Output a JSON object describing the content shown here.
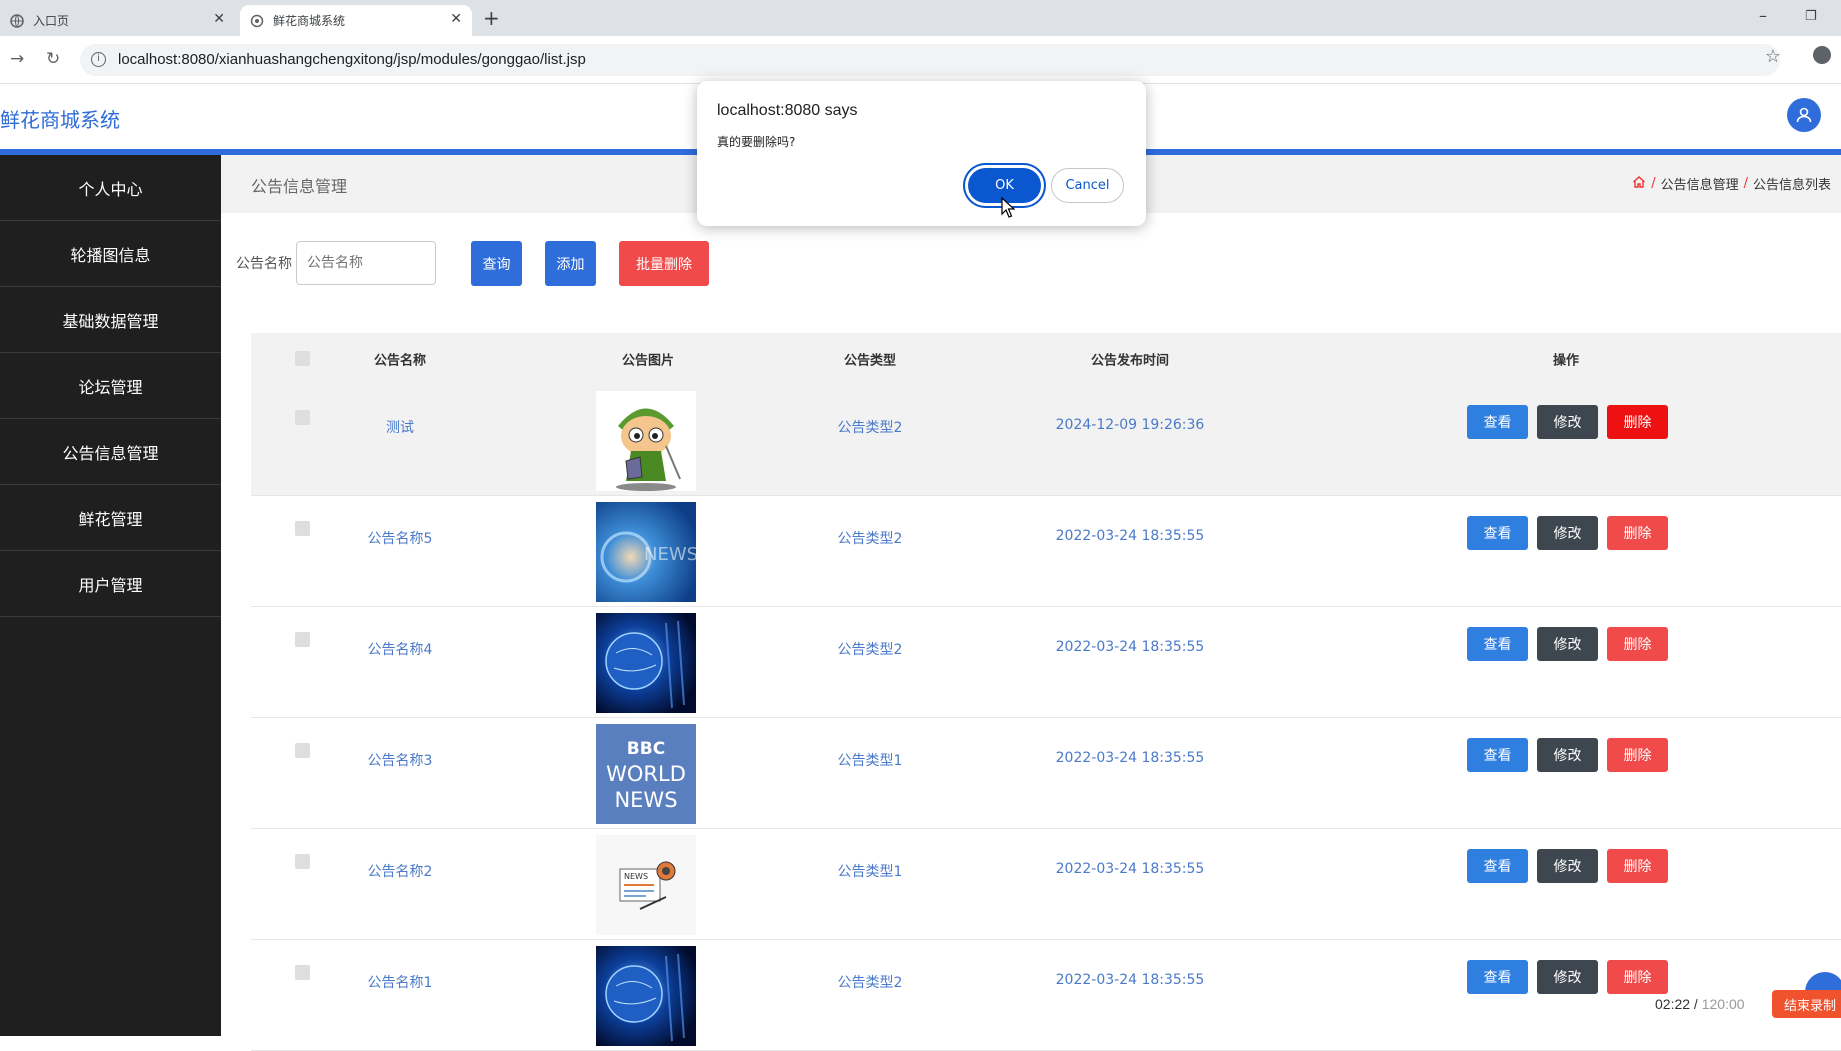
{
  "browser": {
    "tabs": [
      {
        "label": "入口页",
        "active": false
      },
      {
        "label": "鲜花商城系统",
        "active": true
      }
    ],
    "url": "localhost:8080/xianhuashangchengxitong/jsp/modules/gonggao/list.jsp"
  },
  "app": {
    "title": "鲜花商城系统",
    "accent": "#2f6ddb"
  },
  "sidebar": {
    "items": [
      {
        "label": "个人中心"
      },
      {
        "label": "轮播图信息"
      },
      {
        "label": "基础数据管理"
      },
      {
        "label": "论坛管理"
      },
      {
        "label": "公告信息管理"
      },
      {
        "label": "鲜花管理"
      },
      {
        "label": "用户管理"
      }
    ]
  },
  "page": {
    "title": "公告信息管理",
    "breadcrumb": [
      "公告信息管理",
      "公告信息列表"
    ]
  },
  "search": {
    "label": "公告名称",
    "placeholder": "公告名称",
    "query_button": "查询",
    "add_button": "添加",
    "batch_delete_button": "批量删除"
  },
  "table": {
    "columns": [
      "公告名称",
      "公告图片",
      "公告类型",
      "公告发布时间",
      "操作"
    ],
    "actions": {
      "view": "查看",
      "edit": "修改",
      "delete": "删除"
    },
    "rows": [
      {
        "name": "测试",
        "type": "公告类型2",
        "time": "2024-12-09 19:26:36",
        "image": "cartoon-character"
      },
      {
        "name": "公告名称5",
        "type": "公告类型2",
        "time": "2022-03-24 18:35:55",
        "image": "news-blue"
      },
      {
        "name": "公告名称4",
        "type": "公告类型2",
        "time": "2022-03-24 18:35:55",
        "image": "globe"
      },
      {
        "name": "公告名称3",
        "type": "公告类型1",
        "time": "2022-03-24 18:35:55",
        "image": "bbc-world-news"
      },
      {
        "name": "公告名称2",
        "type": "公告类型1",
        "time": "2022-03-24 18:35:55",
        "image": "news-icon"
      },
      {
        "name": "公告名称1",
        "type": "公告类型2",
        "time": "2022-03-24 18:35:55",
        "image": "globe"
      }
    ]
  },
  "dialog": {
    "title": "localhost:8080 says",
    "message": "真的要删除吗?",
    "ok": "OK",
    "cancel": "Cancel"
  },
  "recorder": {
    "elapsed": "02:22",
    "separator": " / ",
    "limit": "120:00",
    "stop_label": "结束录制"
  },
  "bbc_logo_text": [
    "BBC",
    "WORLD",
    "NEWS"
  ],
  "news_logo_text": "NEWS"
}
